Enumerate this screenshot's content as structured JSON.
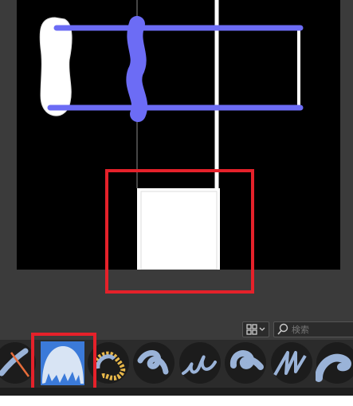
{
  "search": {
    "placeholder": "検索"
  },
  "brushes": [
    {
      "name": "brush-1",
      "selected": false
    },
    {
      "name": "brush-2",
      "selected": true
    },
    {
      "name": "brush-3",
      "selected": false
    },
    {
      "name": "brush-4",
      "selected": false
    },
    {
      "name": "brush-5",
      "selected": false
    },
    {
      "name": "brush-6",
      "selected": false
    },
    {
      "name": "brush-7",
      "selected": false
    },
    {
      "name": "brush-8",
      "selected": false
    }
  ],
  "colors": {
    "stroke_blue": "#6c6cf5",
    "highlight_red": "#e5212a",
    "canvas_bg": "#000000",
    "panel_bg": "#3b3b3b",
    "brush_bg": "#2b2b2b",
    "selected_brush_border": "#3b7ad9"
  }
}
